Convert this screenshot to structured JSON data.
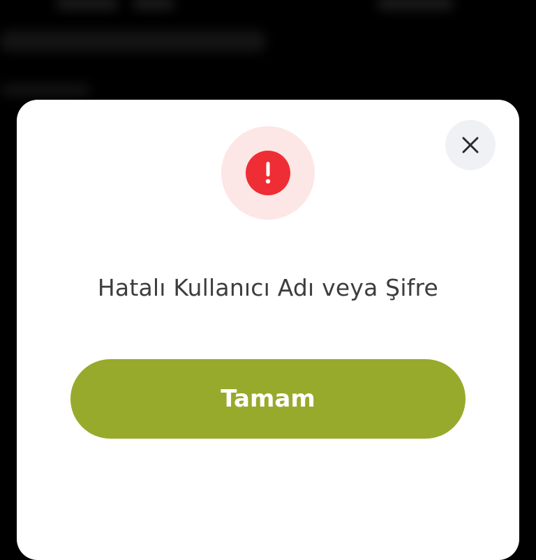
{
  "dialog": {
    "message": "Hatalı Kullanıcı Adı veya Şifre",
    "confirm_label": "Tamam",
    "icons": {
      "status": "error-exclamation-icon",
      "close": "close-icon"
    }
  },
  "colors": {
    "overlay": "#000000",
    "dialog_background": "#ffffff",
    "error_red": "#ee2e34",
    "error_halo": "#fde6e6",
    "confirm_button": "#98aa2b",
    "close_button_bg": "#f0f1f4",
    "message_text": "#3d3d3d"
  }
}
